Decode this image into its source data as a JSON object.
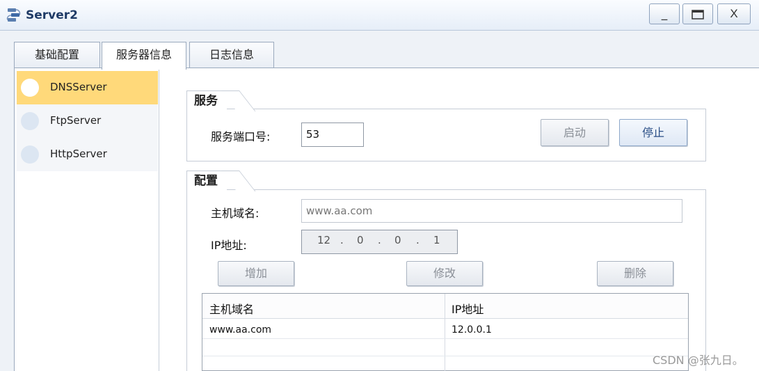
{
  "window": {
    "title": "Server2",
    "minimize_glyph": "_",
    "maximize_glyph": "□",
    "close_glyph": "X",
    "icon": "server-app-icon"
  },
  "tabs": [
    {
      "label": "基础配置"
    },
    {
      "label": "服务器信息"
    },
    {
      "label": "日志信息"
    }
  ],
  "active_tab": "服务器信息",
  "sidebar": {
    "items": [
      {
        "label": "DNSServer",
        "active": true
      },
      {
        "label": "FtpServer",
        "active": false
      },
      {
        "label": "HttpServer",
        "active": false
      }
    ]
  },
  "service": {
    "group_title": "服务",
    "port_label": "服务端口号:",
    "port_value": "53",
    "start_label": "启动",
    "stop_label": "停止"
  },
  "config": {
    "group_title": "配置",
    "domain_label": "主机域名:",
    "domain_value": "www.aa.com",
    "ip_label": "IP地址:",
    "ip_parts": [
      "12",
      "0",
      "0",
      "1"
    ],
    "ip_dot": ".",
    "add_label": "增加",
    "modify_label": "修改",
    "delete_label": "删除"
  },
  "table": {
    "headers": [
      "主机域名",
      "IP地址"
    ],
    "rows": [
      [
        "www.aa.com",
        "12.0.0.1"
      ]
    ]
  },
  "watermark": "CSDN @张九日。",
  "colors": {
    "active_sidebar": "#ffd97a",
    "title_text": "#1f3b66",
    "enabled_button_text": "#2a4e86"
  }
}
